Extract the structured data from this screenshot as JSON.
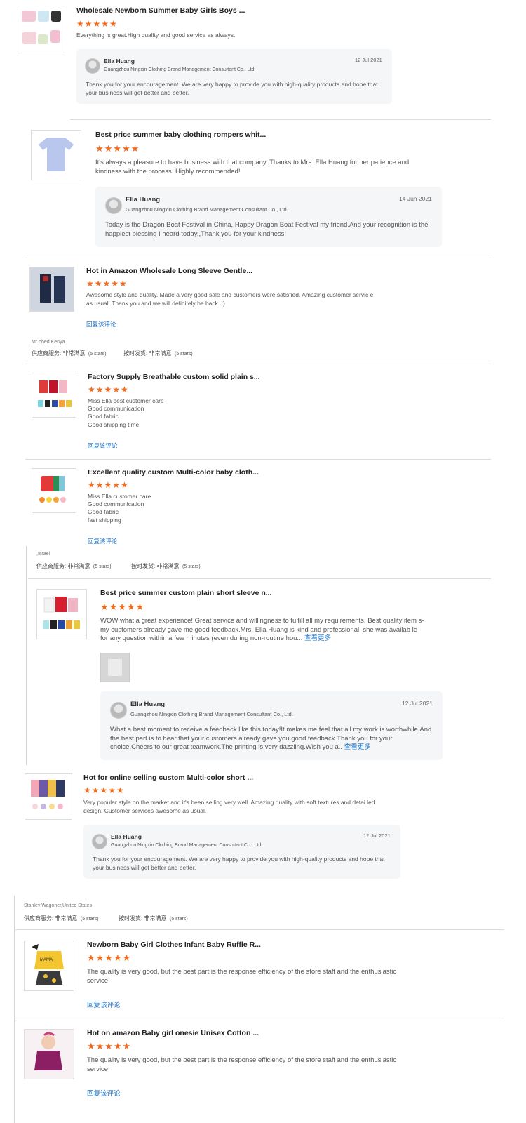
{
  "reviews": [
    {
      "title": "Wholesale Newborn Summer Baby Girls Boys ...",
      "stars": "★★★★★",
      "text": "Everything is great.High quality and good service as always.",
      "reply": {
        "name": "Ella Huang",
        "company": "Guangzhou Ningxin Clothing Brand Management Consultant Co., Ltd.",
        "date": "12 Jul 2021",
        "text": "Thank you for your encouragement. We are very happy to provide you with high-quality products and hope that your business will get better and better."
      }
    },
    {
      "title": "Best price summer baby clothing rompers whit...",
      "stars": "★★★★★",
      "text": "It's always a pleasure to have business with that company. Thanks to Mrs. Ella Huang for her patience and kindness with the process. Highly recommended!",
      "reply": {
        "name": "Ella Huang",
        "company": "Guangzhou Ningxin Clothing Brand Management Consultant Co., Ltd.",
        "date": "14 Jun 2021",
        "text": "Today is the Dragon Boat Festival in China,,Happy Dragon Boat Festival my friend.And your recognition is the happiest blessing I heard today,,Thank you for your kindness!"
      }
    },
    {
      "title": "Hot in Amazon Wholesale Long Sleeve Gentle...",
      "stars": "★★★★★",
      "text": "Awesome style and quality. Made a very good sale and customers were satisfied. Amazing customer servic e as usual. Thank you and we will definitely be back. :)",
      "link": "回复该评论"
    },
    {
      "title": "Factory Supply Breathable custom solid plain s...",
      "stars": "★★★★★",
      "lines": [
        "Miss Ella best customer care",
        "Good communication",
        "Good fabric",
        "Good shipping time"
      ],
      "link": "回复该评论"
    },
    {
      "title": "Excellent quality custom Multi-color baby cloth...",
      "stars": "★★★★★",
      "lines": [
        "Miss Ella customer care",
        "Good communication",
        "Good fabric",
        "fast shipping"
      ],
      "link": "回复该评论"
    },
    {
      "title": "Best price summer custom plain short sleeve n...",
      "stars": "★★★★★",
      "text": "WOW what a great experience! Great service and willingness to fulfill all my requirements. Best quality item s- my customers already gave me good feedback.Mrs. Ella Huang is kind and professional, she was availab le for any question within a few minutes (even during non-routine hou...",
      "more": "查看更多",
      "reply": {
        "name": "Ella Huang",
        "company": "Guangzhou Ningxin Clothing Brand Management Consultant Co., Ltd.",
        "date": "12 Jul 2021",
        "text": "What a best moment to receive a feedback like this today!It makes me feel that all my work is worthwhile.And the best part is to hear that your customers already gave you good feedback.Thank you for your choice.Cheers to our great teamwork.The printing is very dazzling.Wish you a..",
        "more": "查看更多"
      }
    },
    {
      "title": "Hot for online selling custom Multi-color short ...",
      "stars": "★★★★★",
      "text": "Very popular style on the market and it's been selling very well. Amazing quality with soft textures and detai led design. Customer services awesome as usual.",
      "reply": {
        "name": "Ella Huang",
        "company": "Guangzhou Ningxin Clothing Brand Management Consultant Co., Ltd.",
        "date": "12 Jul 2021",
        "text": "Thank you for your encouragement. We are very happy to provide you with high-quality products and hope that your business will get better and better."
      }
    },
    {
      "title": "Newborn Baby Girl Clothes Infant Baby Ruffle R...",
      "stars": "★★★★★",
      "text": "The quality is very good, but the best part is the response efficiency of the store staff and the enthusiastic service.",
      "link": "回复该评论"
    },
    {
      "title": "Hot on amazon Baby girl onesie Unisex Cotton ...",
      "stars": "★★★★★",
      "text": "The quality is very good, but the best part is the response efficiency of the store staff and the enthusiastic service",
      "link": "回复该评论"
    }
  ],
  "reviewers": [
    {
      "name": "Mr ohed,Kenya",
      "supplier_label": "供应商服务:",
      "supplier_value": "非常满意",
      "supplier_stars": "(5 stars)",
      "ship_label": "按时发货:",
      "ship_value": "非常满意",
      "ship_stars": "(5 stars)"
    },
    {
      "name": ",Israel",
      "supplier_label": "供应商服务:",
      "supplier_value": "非常满意",
      "supplier_stars": "(5 stars)",
      "ship_label": "按时发货:",
      "ship_value": "非常满意",
      "ship_stars": "(5 stars)"
    },
    {
      "name": "Stanley Wagoner,United States",
      "supplier_label": "供应商服务:",
      "supplier_value": "非常满意",
      "supplier_stars": "(5 stars)",
      "ship_label": "按时发货:",
      "ship_value": "非常满意",
      "ship_stars": "(5 stars)"
    }
  ]
}
